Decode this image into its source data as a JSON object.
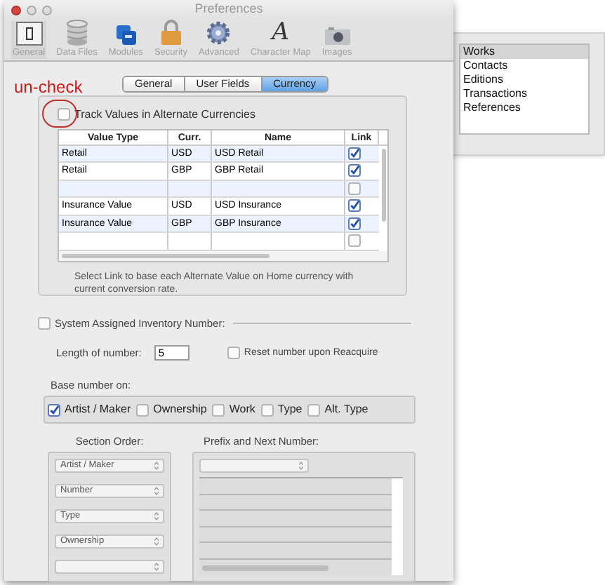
{
  "window": {
    "title": "Preferences"
  },
  "toolbar": [
    {
      "label": "General",
      "kind": "general",
      "selected": true
    },
    {
      "label": "Data Files",
      "kind": "database",
      "selected": false
    },
    {
      "label": "Modules",
      "kind": "modules",
      "selected": false
    },
    {
      "label": "Security",
      "kind": "lock",
      "selected": false
    },
    {
      "label": "Advanced",
      "kind": "gear",
      "selected": false
    },
    {
      "label": "Character Map",
      "kind": "glyph",
      "glyph": "A",
      "selected": false
    },
    {
      "label": "Images",
      "kind": "camera",
      "selected": false
    }
  ],
  "annotation": "un-check",
  "tabs": [
    {
      "label": "General",
      "selected": false
    },
    {
      "label": "User Fields",
      "selected": false
    },
    {
      "label": "Currency",
      "selected": true
    }
  ],
  "track_values": {
    "label": "Track Values in Alternate Currencies",
    "checked": false
  },
  "table": {
    "columns": [
      "Value Type",
      "Curr.",
      "Name",
      "Link"
    ],
    "rows": [
      {
        "value_type": "Retail",
        "currency": "USD",
        "name": "USD Retail",
        "link": true
      },
      {
        "value_type": "Retail",
        "currency": "GBP",
        "name": "GBP Retail",
        "link": true
      },
      {
        "link": false
      },
      {
        "value_type": "Insurance Value",
        "currency": "USD",
        "name": "USD Insurance",
        "link": true
      },
      {
        "value_type": "Insurance Value",
        "currency": "GBP",
        "name": "GBP Insurance",
        "link": true
      },
      {
        "link": false
      }
    ]
  },
  "note": "Select Link to base each Alternate Value on Home currency with current conversion rate.",
  "inventory": {
    "label": "System Assigned Inventory Number:",
    "checked": false
  },
  "length": {
    "label": "Length of number:",
    "value": "5"
  },
  "reset": {
    "label": "Reset number upon Reacquire",
    "checked": false
  },
  "base_label": "Base number on:",
  "base_options": [
    {
      "label": "Artist / Maker",
      "checked": true
    },
    {
      "label": "Ownership",
      "checked": false
    },
    {
      "label": "Work",
      "checked": false
    },
    {
      "label": "Type",
      "checked": false
    },
    {
      "label": "Alt. Type",
      "checked": false
    }
  ],
  "section_order": {
    "label": "Section Order:",
    "items": [
      {
        "kind": "filled",
        "value": "Artist / Maker"
      },
      {
        "kind": "filled",
        "value": "Number"
      },
      {
        "kind": "filled",
        "value": "Type"
      },
      {
        "kind": "filled",
        "value": "Ownership"
      },
      {
        "kind": "empty"
      }
    ]
  },
  "prefix": {
    "label": "Prefix and Next Number:"
  },
  "background_list": {
    "items": [
      {
        "label": "Works",
        "selected": true
      },
      {
        "label": "Contacts",
        "selected": false
      },
      {
        "label": "Editions",
        "selected": false
      },
      {
        "label": "Transactions",
        "selected": false
      },
      {
        "label": "References",
        "selected": false
      }
    ]
  }
}
